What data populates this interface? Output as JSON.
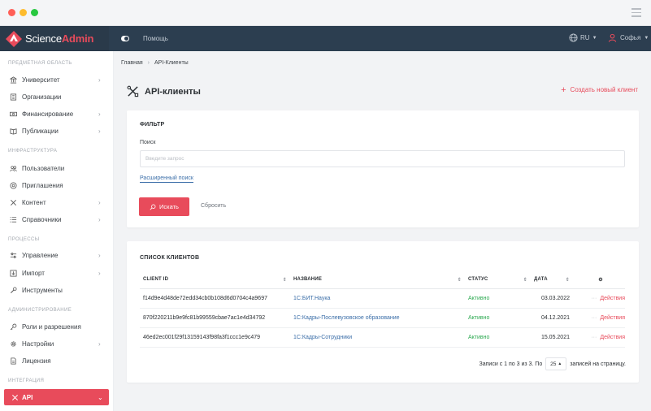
{
  "app": {
    "logo_prefix": "Science",
    "logo_suffix": "Admin",
    "accent": "#e84b5b",
    "topbar_bg": "#2c3e50"
  },
  "topbar": {
    "help_label": "Помощь",
    "lang_label": "RU",
    "user_label": "Софья"
  },
  "sidebar": {
    "sections": [
      {
        "title": "ПРЕДМЕТНАЯ ОБЛАСТЬ",
        "items": [
          {
            "label": "Университет",
            "icon": "bank-icon",
            "chevron": true
          },
          {
            "label": "Организации",
            "icon": "building-icon",
            "chevron": false
          },
          {
            "label": "Финансирование",
            "icon": "money-icon",
            "chevron": true
          },
          {
            "label": "Публикации",
            "icon": "book-icon",
            "chevron": true
          }
        ]
      },
      {
        "title": "ИНФРАСТРУКТУРА",
        "items": [
          {
            "label": "Пользователи",
            "icon": "users-icon",
            "chevron": false
          },
          {
            "label": "Приглашения",
            "icon": "at-icon",
            "chevron": false
          },
          {
            "label": "Контент",
            "icon": "tools-icon",
            "chevron": true
          },
          {
            "label": "Справочники",
            "icon": "list-icon",
            "chevron": true
          }
        ]
      },
      {
        "title": "ПРОЦЕССЫ",
        "items": [
          {
            "label": "Управление",
            "icon": "sliders-icon",
            "chevron": true
          },
          {
            "label": "Импорт",
            "icon": "import-icon",
            "chevron": true
          },
          {
            "label": "Инструменты",
            "icon": "wrench-icon",
            "chevron": false
          }
        ]
      },
      {
        "title": "АДМИНИСТРИРОВАНИЕ",
        "items": [
          {
            "label": "Роли и разрешения",
            "icon": "key-icon",
            "chevron": false
          },
          {
            "label": "Настройки",
            "icon": "gear-icon",
            "chevron": true
          },
          {
            "label": "Лицензия",
            "icon": "document-icon",
            "chevron": false
          }
        ]
      },
      {
        "title": "ИНТЕГРАЦИЯ",
        "items": [
          {
            "label": "API",
            "icon": "api-tools-icon",
            "chevron": true,
            "active": true
          }
        ]
      }
    ]
  },
  "breadcrumb": {
    "home": "Главная",
    "current": "API-Клиенты"
  },
  "page": {
    "title": "API-клиенты",
    "create_label": "Создать новый клиент"
  },
  "filter": {
    "title": "ФИЛЬТР",
    "search_label": "Поиск",
    "search_placeholder": "Введите запрос",
    "search_value": "",
    "advanced_label": "Расширенный поиск",
    "search_button": "Искать",
    "reset_button": "Сбросить"
  },
  "clients": {
    "title": "СПИСОК КЛИЕНТОВ",
    "columns": [
      "CLIENT ID",
      "НАЗВАНИЕ",
      "СТАТУС",
      "ДАТА"
    ],
    "rows": [
      {
        "id": "f14d9e4d48de72edd34cb0b108d6d0704c4a9697",
        "name": "1С:БИТ.Наука",
        "status": "Активно",
        "date": "03.03.2022",
        "action": "Действия"
      },
      {
        "id": "870f220211b9e9fc81b99559cbae7ac1e4d34792",
        "name": "1С:Кадры-Послевузовское образование",
        "status": "Активно",
        "date": "04.12.2021",
        "action": "Действия"
      },
      {
        "id": "46ed2ec001f29f13159143f98fa3f1ccc1e9c479",
        "name": "1С:Кадры-Сотрудники",
        "status": "Активно",
        "date": "15.05.2021",
        "action": "Действия"
      }
    ],
    "pager_text": "Записи с 1 по 3 из 3. По",
    "per_page": "25",
    "per_page_suffix": "записей на страницу."
  }
}
